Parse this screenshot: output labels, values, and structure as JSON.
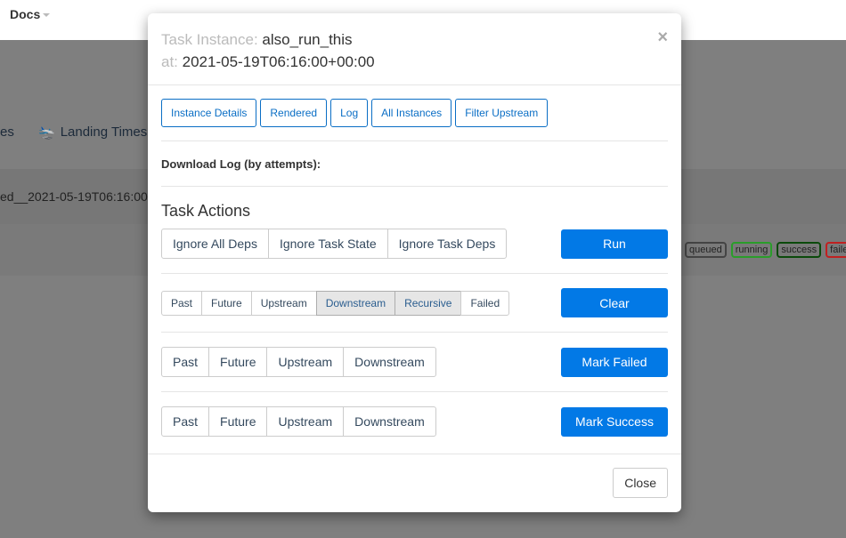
{
  "nav": {
    "docs": "Docs"
  },
  "background": {
    "tab_partial": "es",
    "landing_times": "Landing Times",
    "run_id": "ed__2021-05-19T06:16:00-",
    "legend": [
      "queued",
      "running",
      "success",
      "faile"
    ],
    "legend_colors": [
      "#444444",
      "#2a9d2a",
      "#0b4a0b",
      "#c02020"
    ]
  },
  "modal": {
    "title_label": "Task Instance:",
    "task_id": "also_run_this",
    "at_label": "at:",
    "execution_date": "2021-05-19T06:16:00+00:00",
    "tabs": [
      "Instance Details",
      "Rendered",
      "Log",
      "All Instances",
      "Filter Upstream"
    ],
    "download_log": "Download Log (by attempts):",
    "actions_title": "Task Actions",
    "run": {
      "options": [
        "Ignore All Deps",
        "Ignore Task State",
        "Ignore Task Deps"
      ],
      "button": "Run"
    },
    "clear": {
      "options": [
        "Past",
        "Future",
        "Upstream",
        "Downstream",
        "Recursive",
        "Failed"
      ],
      "active": [
        "Downstream",
        "Recursive"
      ],
      "button": "Clear"
    },
    "mark_failed": {
      "options": [
        "Past",
        "Future",
        "Upstream",
        "Downstream"
      ],
      "button": "Mark Failed"
    },
    "mark_success": {
      "options": [
        "Past",
        "Future",
        "Upstream",
        "Downstream"
      ],
      "button": "Mark Success"
    },
    "close": "Close",
    "accent": "#0279e6"
  }
}
